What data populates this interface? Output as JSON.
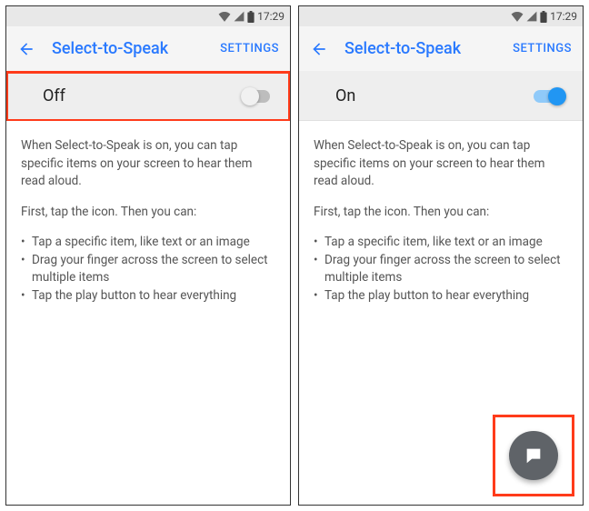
{
  "status": {
    "time": "17:29"
  },
  "screens": [
    {
      "title": "Select-to-Speak",
      "settings_label": "SETTINGS",
      "toggle": {
        "label": "Off",
        "on": false,
        "highlighted": true
      },
      "desc": {
        "p1": "When Select-to-Speak is on, you can tap specific items on your screen to hear them read aloud.",
        "p2": "First, tap the icon. Then you can:",
        "bullets": [
          "Tap a specific item, like text or an image",
          "Drag your finger across the screen to select multiple items",
          "Tap the play button to hear everything"
        ]
      },
      "fab": {
        "visible": false,
        "highlighted": false
      }
    },
    {
      "title": "Select-to-Speak",
      "settings_label": "SETTINGS",
      "toggle": {
        "label": "On",
        "on": true,
        "highlighted": false
      },
      "desc": {
        "p1": "When Select-to-Speak is on, you can tap specific items on your screen to hear them read aloud.",
        "p2": "First, tap the icon. Then you can:",
        "bullets": [
          "Tap a specific item, like text or an image",
          "Drag your finger across the screen to select multiple items",
          "Tap the play button to hear everything"
        ]
      },
      "fab": {
        "visible": true,
        "highlighted": true
      }
    }
  ]
}
